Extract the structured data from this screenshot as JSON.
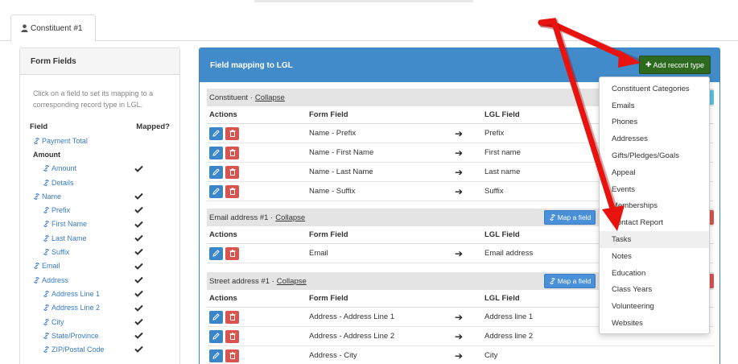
{
  "tab": {
    "label": "Constituent #1"
  },
  "left_panel": {
    "title": "Form Fields",
    "help": "Click on a field to set its mapping to a corresponding record type in LGL.",
    "col_field": "Field",
    "col_mapped": "Mapped?",
    "rows": [
      {
        "label": "Payment Total",
        "link": true,
        "indent": 1,
        "mapped": false
      },
      {
        "label": "Amount",
        "link": false,
        "indent": 1,
        "mapped": false
      },
      {
        "label": "Amount",
        "link": true,
        "indent": 2,
        "mapped": true
      },
      {
        "label": "Details",
        "link": true,
        "indent": 2,
        "mapped": false
      },
      {
        "label": "Name",
        "link": true,
        "indent": 1,
        "mapped": true
      },
      {
        "label": "Prefix",
        "link": true,
        "indent": 2,
        "mapped": true
      },
      {
        "label": "First Name",
        "link": true,
        "indent": 2,
        "mapped": true
      },
      {
        "label": "Last Name",
        "link": true,
        "indent": 2,
        "mapped": true
      },
      {
        "label": "Suffix",
        "link": true,
        "indent": 2,
        "mapped": true
      },
      {
        "label": "Email",
        "link": true,
        "indent": 1,
        "mapped": true
      },
      {
        "label": "Address",
        "link": true,
        "indent": 1,
        "mapped": true
      },
      {
        "label": "Address Line 1",
        "link": true,
        "indent": 2,
        "mapped": true
      },
      {
        "label": "Address Line 2",
        "link": true,
        "indent": 2,
        "mapped": true
      },
      {
        "label": "City",
        "link": true,
        "indent": 2,
        "mapped": true
      },
      {
        "label": "State/Province",
        "link": true,
        "indent": 2,
        "mapped": true
      },
      {
        "label": "ZIP/Postal Code",
        "link": true,
        "indent": 2,
        "mapped": true
      }
    ]
  },
  "right_panel": {
    "title": "Field mapping to LGL",
    "add_button": "Add record type",
    "collapse_label": "Collapse",
    "map_button": "Map a field",
    "columns": {
      "actions": "Actions",
      "form_field": "Form Field",
      "lgl_field": "LGL Field"
    },
    "sections": [
      {
        "title": "Constituent ·",
        "rows": [
          {
            "form": "Name - Prefix",
            "lgl": "Prefix"
          },
          {
            "form": "Name - First Name",
            "lgl": "First name"
          },
          {
            "form": "Name - Last Name",
            "lgl": "Last name"
          },
          {
            "form": "Name - Suffix",
            "lgl": "Suffix"
          }
        ]
      },
      {
        "title": "Email address #1 ·",
        "rows": [
          {
            "form": "Email",
            "lgl": "Email address"
          }
        ]
      },
      {
        "title": "Street address #1 ·",
        "rows": [
          {
            "form": "Address - Address Line 1",
            "lgl": "Address line 1"
          },
          {
            "form": "Address - Address Line 2",
            "lgl": "Address line 2"
          },
          {
            "form": "Address - City",
            "lgl": "City"
          }
        ]
      }
    ]
  },
  "dropdown": {
    "items": [
      "Constituent Categories",
      "Emails",
      "Phones",
      "Addresses",
      "Gifts/Pledges/Goals",
      "Appeal",
      "Events",
      "Memberships",
      "Contact Report",
      "Tasks",
      "Notes",
      "Education",
      "Class Years",
      "Volunteering",
      "Websites"
    ],
    "highlighted": "Tasks"
  },
  "colors": {
    "header_blue": "#428bca",
    "add_green": "#2d6a1f",
    "link_blue": "#3a7bc8",
    "annotation_red": "#e8130f"
  }
}
